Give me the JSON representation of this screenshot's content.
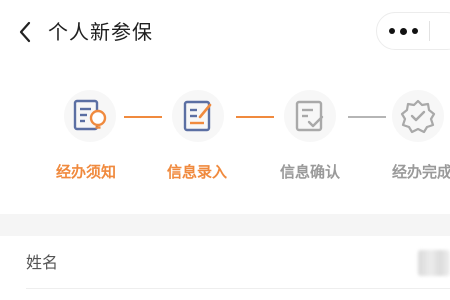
{
  "header": {
    "title": "个人新参保",
    "back_icon": "chevron-left-icon",
    "more_icon": "more-dots-icon"
  },
  "steps": [
    {
      "label": "经办须知",
      "status": "done",
      "icon": "doc-bulb-icon"
    },
    {
      "label": "信息录入",
      "status": "done",
      "icon": "doc-edit-icon"
    },
    {
      "label": "信息确认",
      "status": "todo",
      "icon": "doc-check-icon"
    },
    {
      "label": "经办完成",
      "status": "todo",
      "icon": "badge-check-icon"
    }
  ],
  "form": {
    "name_label": "姓名"
  },
  "colors": {
    "accent": "#f08a3e",
    "inactive": "#9a9a9a"
  }
}
